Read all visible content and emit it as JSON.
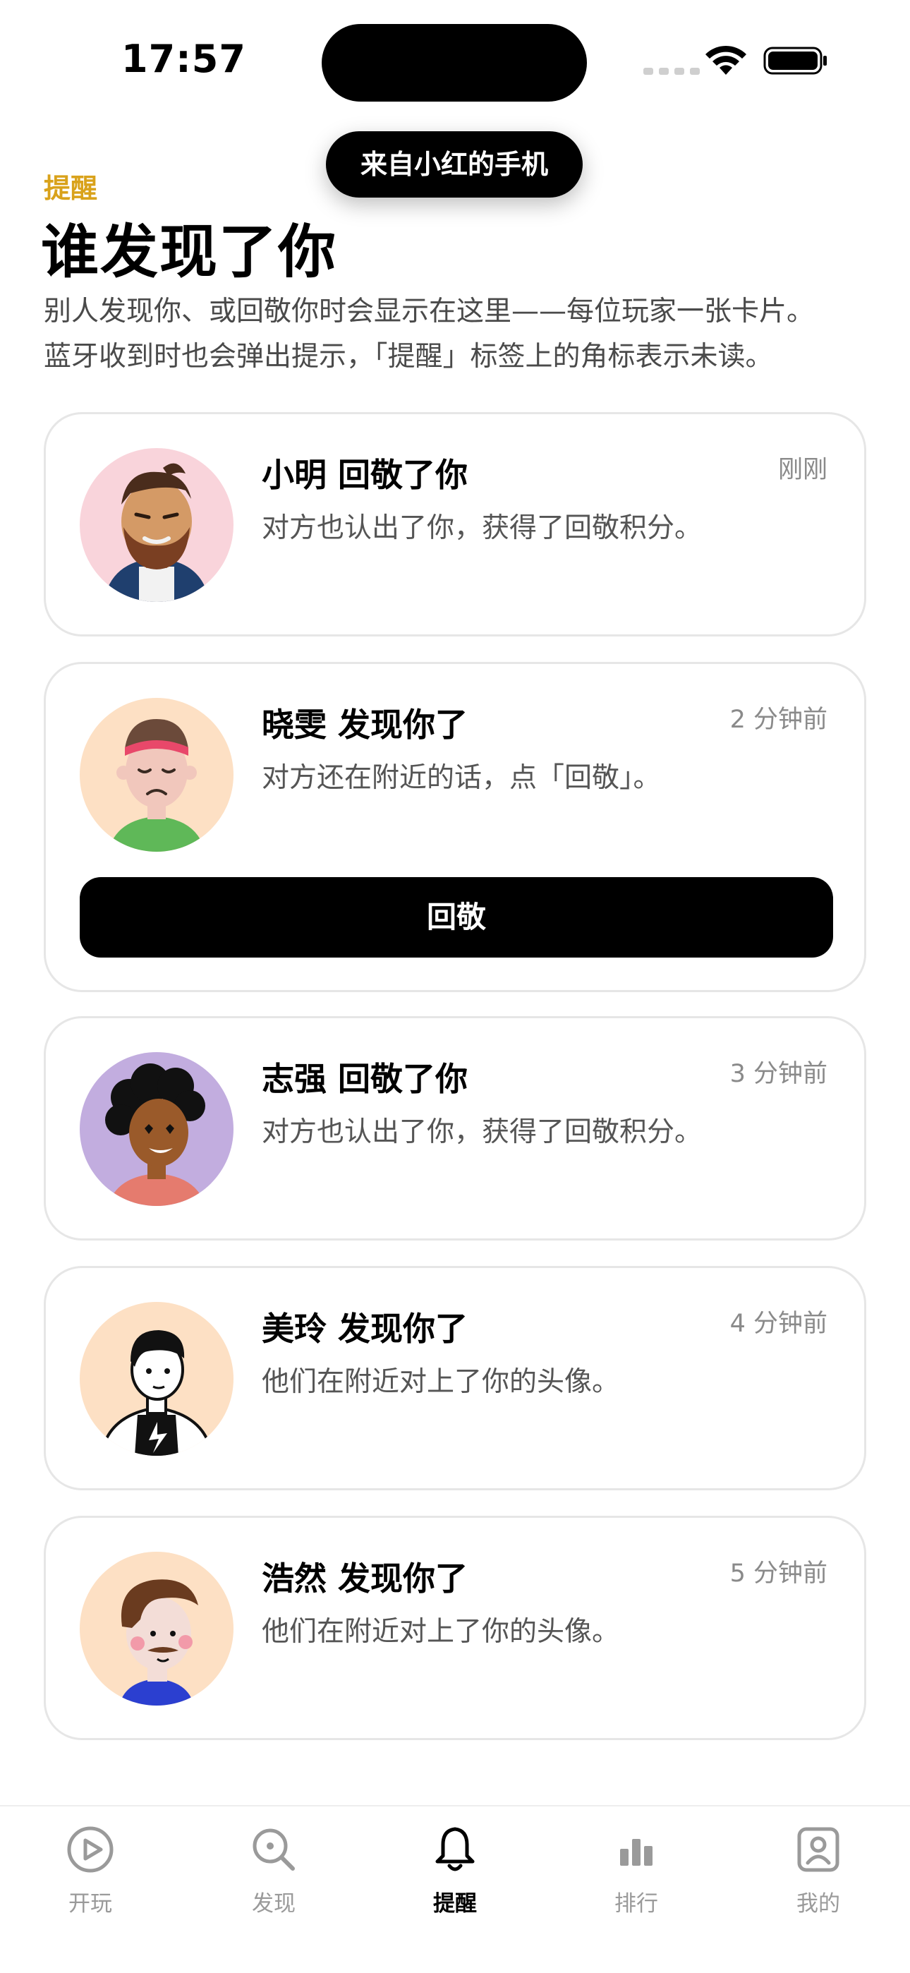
{
  "status_bar": {
    "time": "17:57"
  },
  "toast": {
    "text": "来自小红的手机"
  },
  "header": {
    "overline": "提醒",
    "title": "谁发现了你",
    "description_line1": "别人发现你、或回敬你时会显示在这里——每位玩家一张卡片。",
    "description_line2": "蓝牙收到时也会弹出提示，「提醒」标签上的角标表示未读。"
  },
  "notifications": [
    {
      "title": "小明 回敬了你",
      "time": "刚刚",
      "message": "对方也认出了你，获得了回敬积分。",
      "avatar_bg": "#f9d4db"
    },
    {
      "title": "晓雯 发现你了",
      "time": "2 分钟前",
      "message": "对方还在附近的话，点「回敬」。",
      "action_label": "回敬",
      "avatar_bg": "#fde0c4"
    },
    {
      "title": "志强 回敬了你",
      "time": "3 分钟前",
      "message": "对方也认出了你，获得了回敬积分。",
      "avatar_bg": "#c2addf"
    },
    {
      "title": "美玲 发现你了",
      "time": "4 分钟前",
      "message": "他们在附近对上了你的头像。",
      "avatar_bg": "#fde0c4"
    },
    {
      "title": "浩然 发现你了",
      "time": "5 分钟前",
      "message": "他们在附近对上了你的头像。",
      "avatar_bg": "#fde0c4"
    }
  ],
  "tabbar": {
    "active": "提醒",
    "tabs": [
      {
        "label": "开玩",
        "icon": "play-icon"
      },
      {
        "label": "发现",
        "icon": "search-icon"
      },
      {
        "label": "提醒",
        "icon": "bell-icon"
      },
      {
        "label": "排行",
        "icon": "bar-chart-icon"
      },
      {
        "label": "我的",
        "icon": "profile-icon"
      }
    ]
  },
  "colors": {
    "accent": "#d9a21b",
    "primary": "#000000",
    "card_border": "#e6e6e6"
  }
}
